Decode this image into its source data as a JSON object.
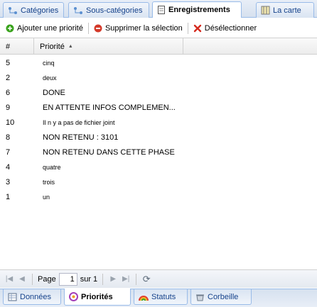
{
  "top_tabs": [
    {
      "label": "Catégories",
      "icon": "category-icon",
      "active": false
    },
    {
      "label": "Sous-catégories",
      "icon": "subcategory-icon",
      "active": false
    },
    {
      "label": "Enregistrements",
      "icon": "document-icon",
      "active": true
    },
    {
      "label": "La carte",
      "icon": "map-icon",
      "active": false
    }
  ],
  "toolbar": {
    "add_label": "Ajouter une priorité",
    "delete_label": "Supprimer la sélection",
    "deselect_label": "Désélectionner"
  },
  "grid": {
    "columns": [
      "#",
      "Priorité"
    ],
    "sort_column": "Priorité",
    "sort_direction": "ascending",
    "rows": [
      {
        "id": "5",
        "priorite": "cinq"
      },
      {
        "id": "2",
        "priorite": "deux"
      },
      {
        "id": "6",
        "priorite": "DONE"
      },
      {
        "id": "9",
        "priorite": "EN ATTENTE INFOS COMPLEMEN..."
      },
      {
        "id": "10",
        "priorite": "Il n y a pas de fichier joint"
      },
      {
        "id": "8",
        "priorite": "NON RETENU : 3101"
      },
      {
        "id": "7",
        "priorite": "NON RETENU DANS CETTE PHASE"
      },
      {
        "id": "4",
        "priorite": "quatre"
      },
      {
        "id": "3",
        "priorite": "trois"
      },
      {
        "id": "1",
        "priorite": "un"
      }
    ]
  },
  "paging": {
    "page_label": "Page",
    "current_page": "1",
    "of_label": "sur 1"
  },
  "bottom_tabs": [
    {
      "label": "Données",
      "icon": "data-icon",
      "active": false
    },
    {
      "label": "Priorités",
      "icon": "priority-icon",
      "active": true
    },
    {
      "label": "Statuts",
      "icon": "status-icon",
      "active": false
    },
    {
      "label": "Corbeille",
      "icon": "trash-icon",
      "active": false
    }
  ],
  "colors": {
    "tab_border": "#99bbe8",
    "tab_text": "#15428b",
    "add_green": "#3aa31d",
    "delete_red": "#d43a2a"
  }
}
